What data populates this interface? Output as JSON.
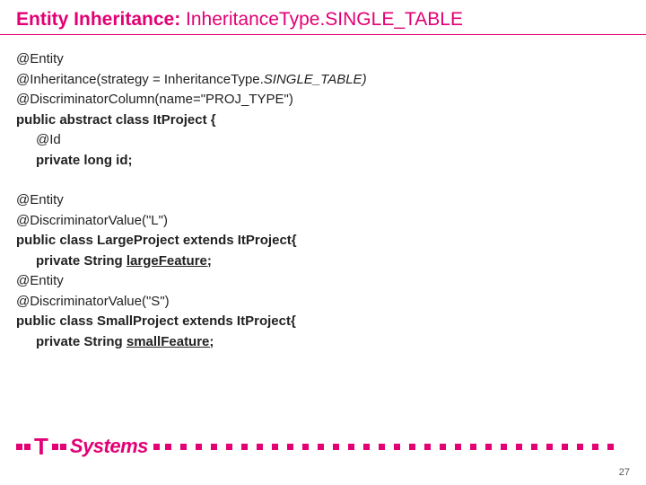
{
  "title": {
    "prefix": "Entity Inheritance: ",
    "suffix": "InheritanceType.SINGLE_TABLE"
  },
  "code": {
    "l1": "@Entity",
    "l2a": "@Inheritance(strategy = InheritanceType.",
    "l2b": "SINGLE_TABLE)",
    "l3": "@DiscriminatorColumn(name=\"PROJ_TYPE\")",
    "l4": "public abstract class ItProject {",
    "l5": "@Id",
    "l6": "private long id;",
    "l7": "@Entity",
    "l8": "@DiscriminatorValue(\"L\")",
    "l9": "public class LargeProject extends ItProject{",
    "l10a": "private String ",
    "l10b": "largeFeature;",
    "l11": "@Entity",
    "l12": "@DiscriminatorValue(\"S\")",
    "l13": "public class SmallProject extends ItProject{",
    "l14a": "private String ",
    "l14b": "smallFeature;"
  },
  "logo": {
    "t": "T",
    "systems": "Systems"
  },
  "page_number": "27"
}
